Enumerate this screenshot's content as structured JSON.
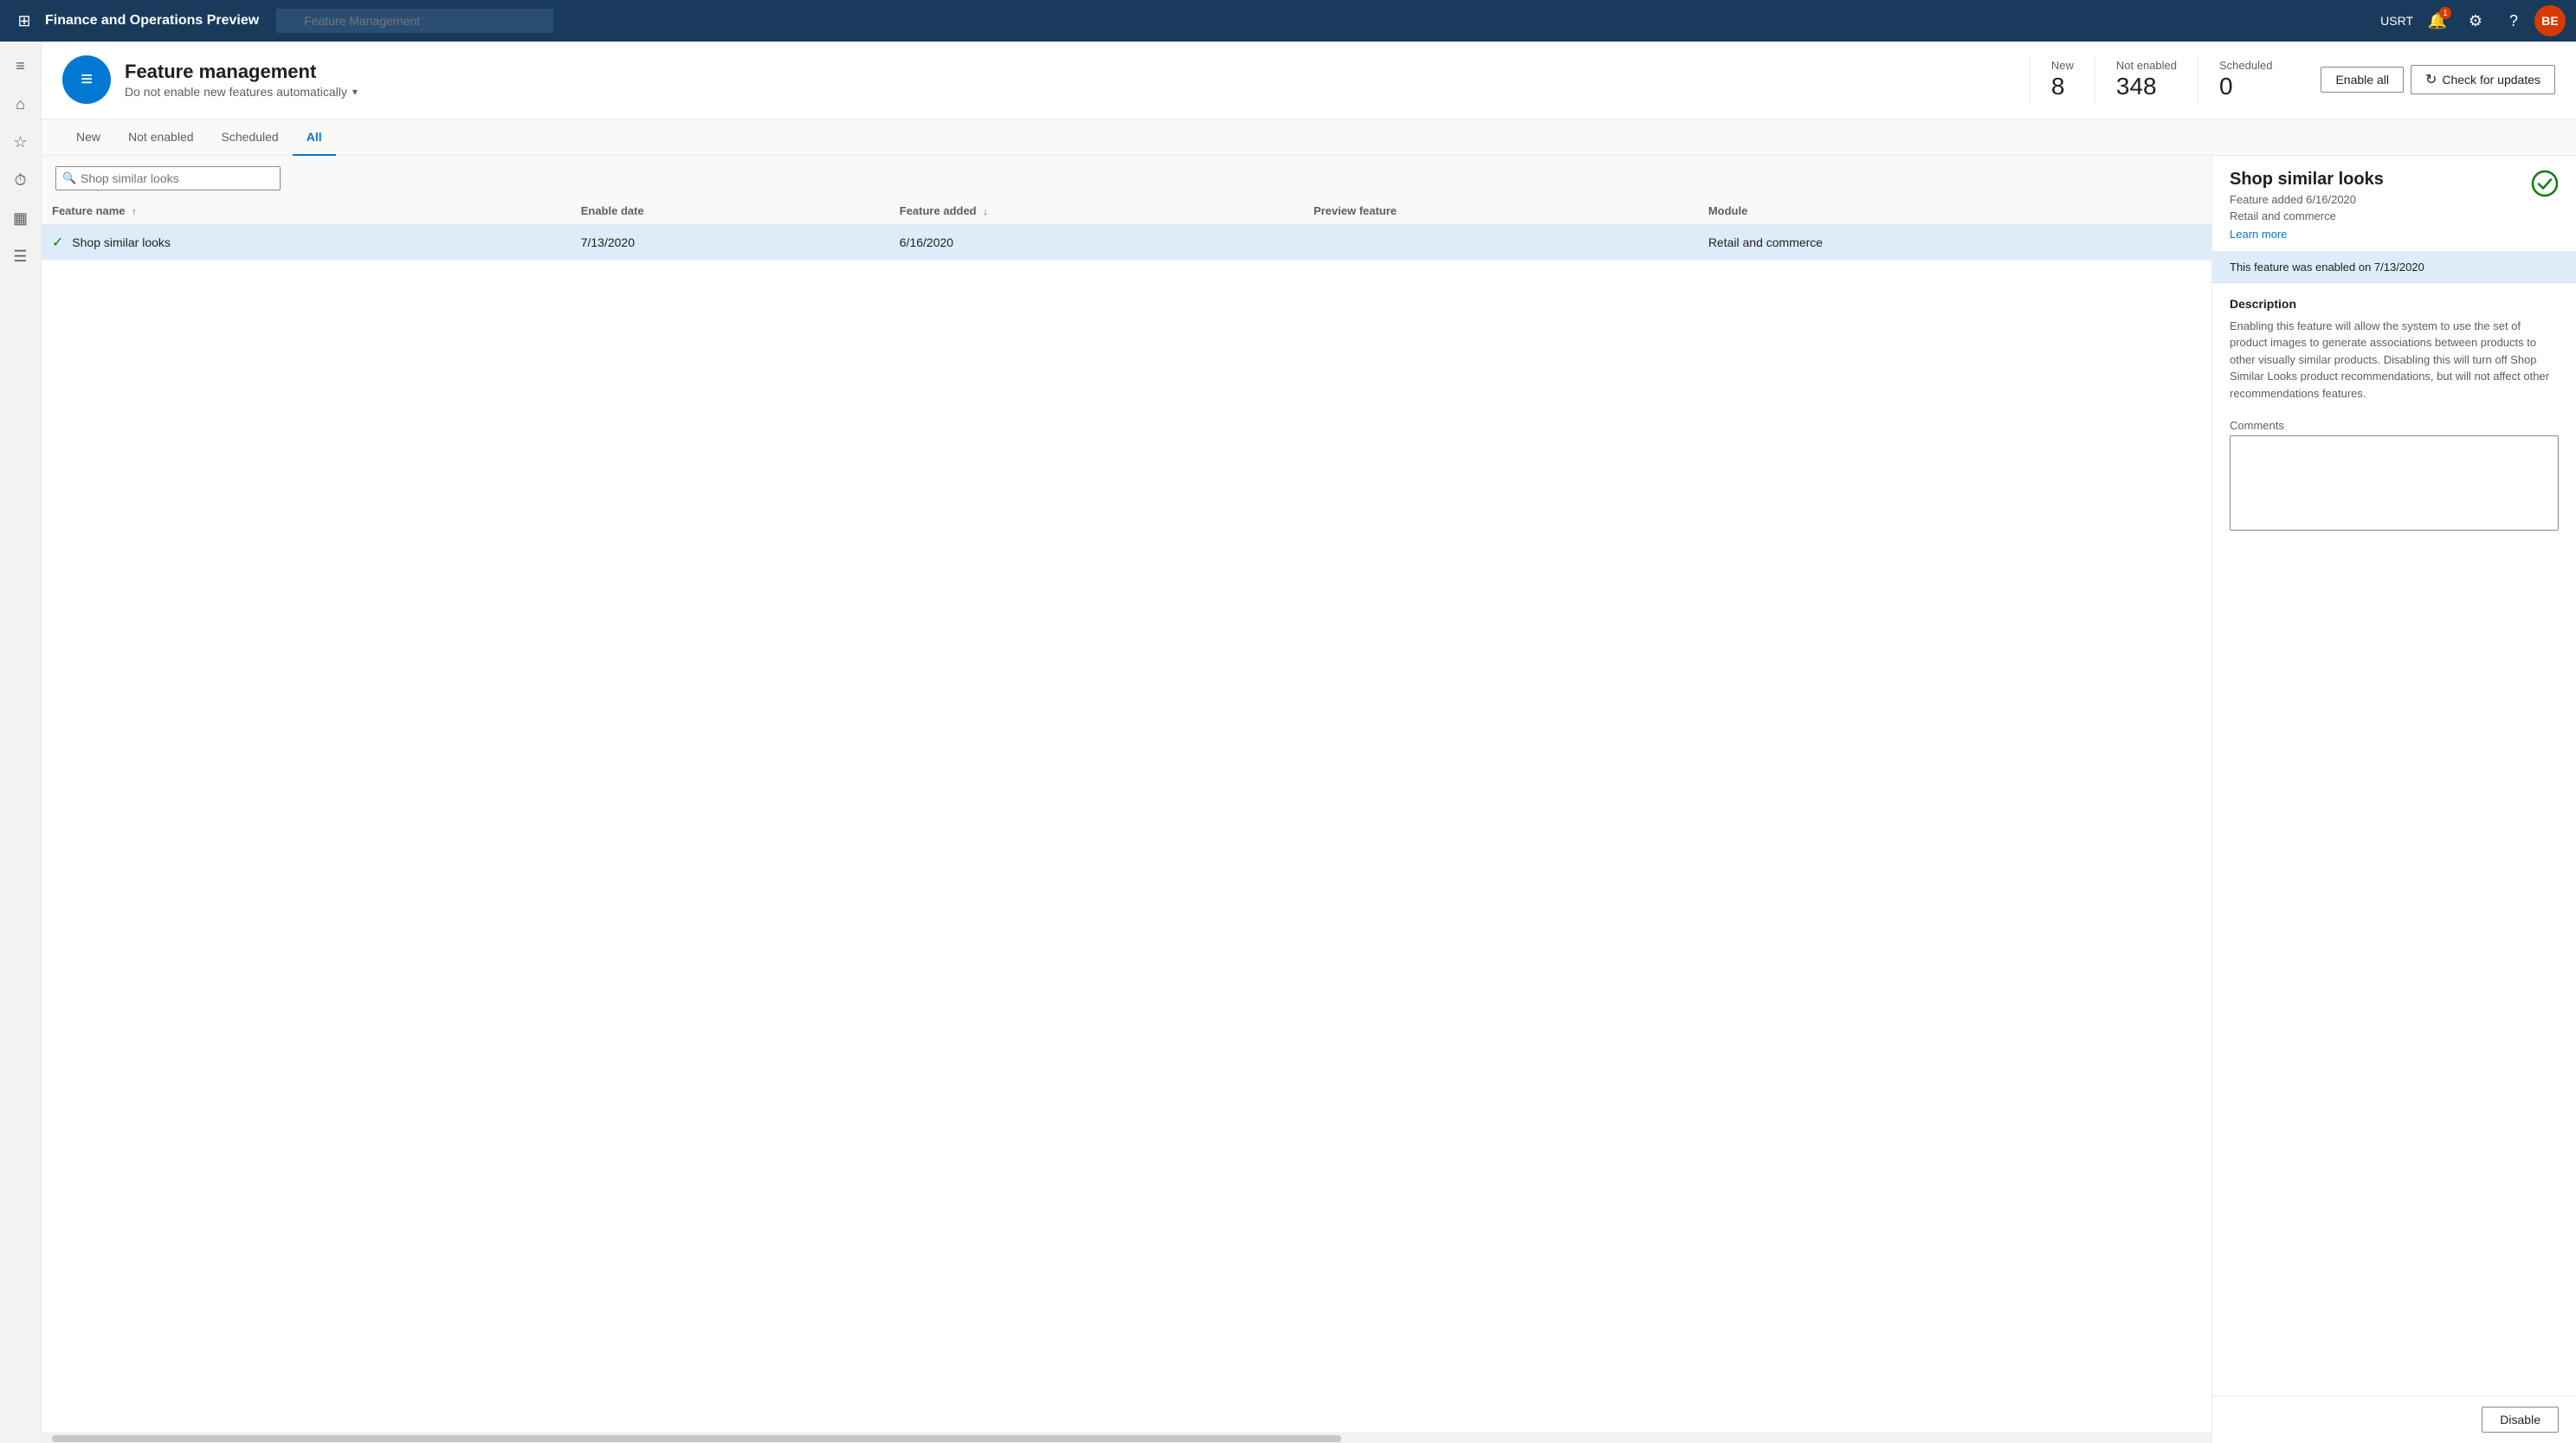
{
  "topnav": {
    "title": "Finance and Operations Preview",
    "search_placeholder": "Feature Management",
    "username": "USRT",
    "user_initials": "BE"
  },
  "page_header": {
    "title": "Feature management",
    "subtitle": "Do not enable new features automatically",
    "stats": [
      {
        "label": "New",
        "value": "8"
      },
      {
        "label": "Not enabled",
        "value": "348"
      },
      {
        "label": "Scheduled",
        "value": "0"
      }
    ],
    "enable_all_label": "Enable all",
    "check_updates_label": "Check for updates"
  },
  "tabs": [
    {
      "label": "New",
      "active": false
    },
    {
      "label": "Not enabled",
      "active": false
    },
    {
      "label": "Scheduled",
      "active": false
    },
    {
      "label": "All",
      "active": true
    }
  ],
  "table": {
    "search_placeholder": "Shop similar looks",
    "columns": [
      {
        "label": "Feature name",
        "sort": "asc"
      },
      {
        "label": "Enable date",
        "sort": null
      },
      {
        "label": "Feature added",
        "sort": "desc"
      },
      {
        "label": "Preview feature",
        "sort": null
      },
      {
        "label": "Module",
        "sort": null
      }
    ],
    "rows": [
      {
        "feature_name": "Shop similar looks",
        "enabled": true,
        "enable_date": "7/13/2020",
        "feature_added": "6/16/2020",
        "preview_feature": "",
        "module": "Retail and commerce",
        "selected": true
      }
    ]
  },
  "detail": {
    "title": "Shop similar looks",
    "meta_line1": "Feature added 6/16/2020",
    "meta_line2": "Retail and commerce",
    "learn_more": "Learn more",
    "enabled_banner": "This feature was enabled on 7/13/2020",
    "description_title": "Description",
    "description": "Enabling this feature will allow the system to use the set of product images to generate associations between products to other visually similar products. Disabling this will turn off Shop Similar Looks product recommendations, but will not affect other recommendations features.",
    "comments_label": "Comments",
    "disable_label": "Disable"
  },
  "leftnav": {
    "items": [
      {
        "icon": "≡",
        "name": "hamburger"
      },
      {
        "icon": "⌂",
        "name": "home"
      },
      {
        "icon": "★",
        "name": "favorites"
      },
      {
        "icon": "⏱",
        "name": "recent"
      },
      {
        "icon": "▦",
        "name": "workspaces"
      },
      {
        "icon": "☰",
        "name": "modules"
      }
    ]
  }
}
